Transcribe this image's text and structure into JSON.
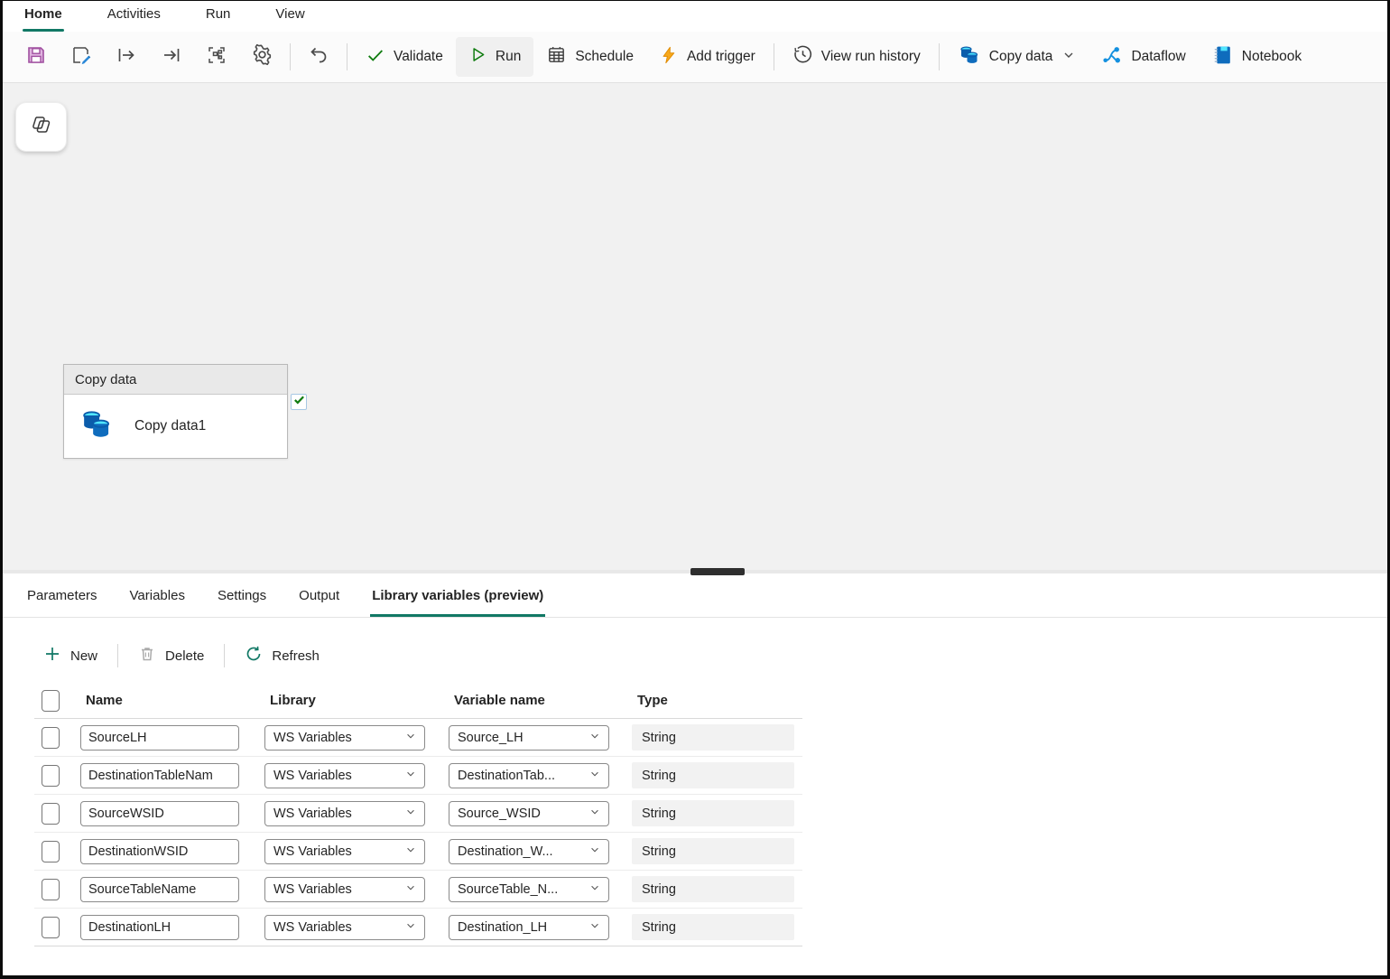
{
  "ribbon": {
    "tabs": [
      {
        "label": "Home",
        "active": true
      },
      {
        "label": "Activities",
        "active": false
      },
      {
        "label": "Run",
        "active": false
      },
      {
        "label": "View",
        "active": false
      }
    ]
  },
  "toolbar": {
    "icon_buttons": [
      "save-icon",
      "save-as-icon",
      "export-arrow-icon",
      "import-arrow-icon",
      "fit-to-canvas-icon",
      "settings-gear-icon",
      "undo-icon"
    ],
    "validate_label": "Validate",
    "run_label": "Run",
    "schedule_label": "Schedule",
    "add_trigger_label": "Add trigger",
    "view_run_history_label": "View run history",
    "copy_data_label": "Copy data",
    "dataflow_label": "Dataflow",
    "notebook_label": "Notebook"
  },
  "canvas": {
    "copilot_button_icon": "copilot-icon",
    "activity_card": {
      "header": "Copy data",
      "title": "Copy data1",
      "status": "checked"
    }
  },
  "panel": {
    "tabs": [
      {
        "label": "Parameters",
        "active": false
      },
      {
        "label": "Variables",
        "active": false
      },
      {
        "label": "Settings",
        "active": false
      },
      {
        "label": "Output",
        "active": false
      },
      {
        "label": "Library variables (preview)",
        "active": true
      }
    ],
    "commands": {
      "new": "New",
      "delete": "Delete",
      "refresh": "Refresh"
    },
    "table": {
      "columns": [
        "Name",
        "Library",
        "Variable name",
        "Type"
      ],
      "rows": [
        {
          "name": "SourceLH",
          "library": "WS Variables",
          "variable": "Source_LH",
          "type": "String"
        },
        {
          "name": "DestinationTableNam",
          "library": "WS Variables",
          "variable": "DestinationTab...",
          "type": "String"
        },
        {
          "name": "SourceWSID",
          "library": "WS Variables",
          "variable": "Source_WSID",
          "type": "String"
        },
        {
          "name": "DestinationWSID",
          "library": "WS Variables",
          "variable": "Destination_W...",
          "type": "String"
        },
        {
          "name": "SourceTableName",
          "library": "WS Variables",
          "variable": "SourceTable_N...",
          "type": "String"
        },
        {
          "name": "DestinationLH",
          "library": "WS Variables",
          "variable": "Destination_LH",
          "type": "String"
        }
      ]
    }
  },
  "colors": {
    "accent_teal": "#117865",
    "success_green": "#107C10",
    "brand_blue": "#0F6CBD",
    "light_blue": "#50E6FF",
    "save_purple": "#A04FA0",
    "trigger_orange": "#F7A81B"
  }
}
